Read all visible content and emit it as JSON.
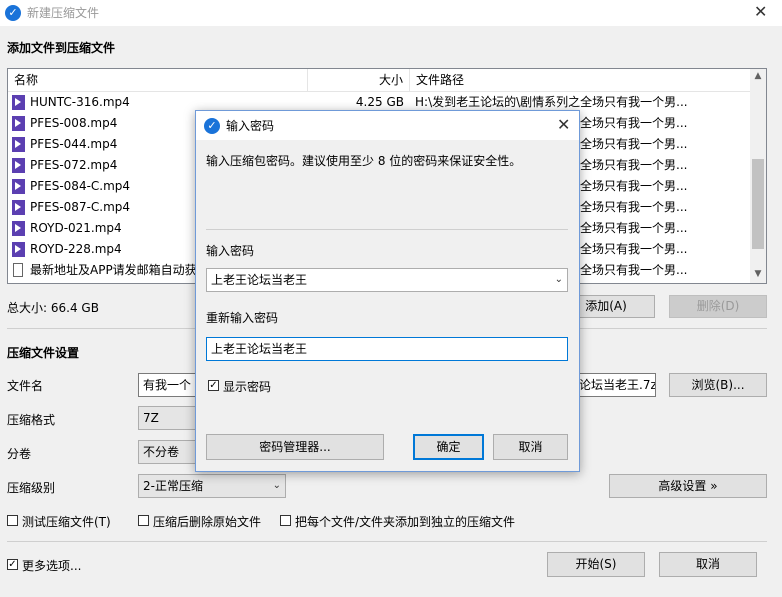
{
  "window": {
    "title": "新建压缩文件"
  },
  "files_section": {
    "title": "添加文件到压缩文件",
    "columns": {
      "name": "名称",
      "size": "大小",
      "path": "文件路径"
    },
    "rows": [
      {
        "name": "HUNTC-316.mp4",
        "size": "4.25 GB",
        "path": "H:\\发到老王论坛的\\剧情系列之全场只有我一个男...",
        "icon": "mp4-file-icon"
      },
      {
        "name": "PFES-008.mp4",
        "size": "",
        "path": "全场只有我一个男...",
        "icon": "mp4-file-icon"
      },
      {
        "name": "PFES-044.mp4",
        "size": "",
        "path": "全场只有我一个男...",
        "icon": "mp4-file-icon"
      },
      {
        "name": "PFES-072.mp4",
        "size": "",
        "path": "全场只有我一个男...",
        "icon": "mp4-file-icon"
      },
      {
        "name": "PFES-084-C.mp4",
        "size": "",
        "path": "全场只有我一个男...",
        "icon": "mp4-file-icon"
      },
      {
        "name": "PFES-087-C.mp4",
        "size": "",
        "path": "全场只有我一个男...",
        "icon": "mp4-file-icon"
      },
      {
        "name": "ROYD-021.mp4",
        "size": "",
        "path": "全场只有我一个男...",
        "icon": "mp4-file-icon"
      },
      {
        "name": "ROYD-228.mp4",
        "size": "",
        "path": "全场只有我一个男...",
        "icon": "mp4-file-icon"
      },
      {
        "name": "最新地址及APP请发邮箱自动获",
        "size": "",
        "path": "全场只有我一个男...",
        "icon": "text-file-icon"
      }
    ],
    "total_size": "总大小: 66.4 GB",
    "add_button": "添加(A)",
    "delete_button": "删除(D)"
  },
  "settings": {
    "title": "压缩文件设置",
    "filename_label": "文件名",
    "filename_value_left": "有我一个",
    "filename_value_right": "论坛当老王.7z",
    "browse_button": "浏览(B)...",
    "format_label": "压缩格式",
    "format_value": "7Z",
    "split_label": "分卷",
    "split_value": "不分卷",
    "level_label": "压缩级别",
    "level_value": "2-正常压缩",
    "advanced_button": "高级设置 »",
    "test_checkbox": "测试压缩文件(T)",
    "delete_after_checkbox": "压缩后删除原始文件",
    "separate_checkbox": "把每个文件/文件夹添加到独立的压缩文件",
    "more_options_checkbox": "更多选项...",
    "start_button": "开始(S)",
    "cancel_button": "取消"
  },
  "password_dialog": {
    "title": "输入密码",
    "hint": "输入压缩包密码。建议使用至少 8 位的密码来保证安全性。",
    "password_label": "输入密码",
    "password_value": "上老王论坛当老王",
    "confirm_label": "重新输入密码",
    "confirm_value": "上老王论坛当老王",
    "show_password": "显示密码",
    "manager_button": "密码管理器...",
    "ok_button": "确定",
    "cancel_button": "取消"
  },
  "colors": {
    "accent": "#0078d7",
    "app_icon": "#1a73d9",
    "mp4_icon": "#5b3fb1"
  }
}
